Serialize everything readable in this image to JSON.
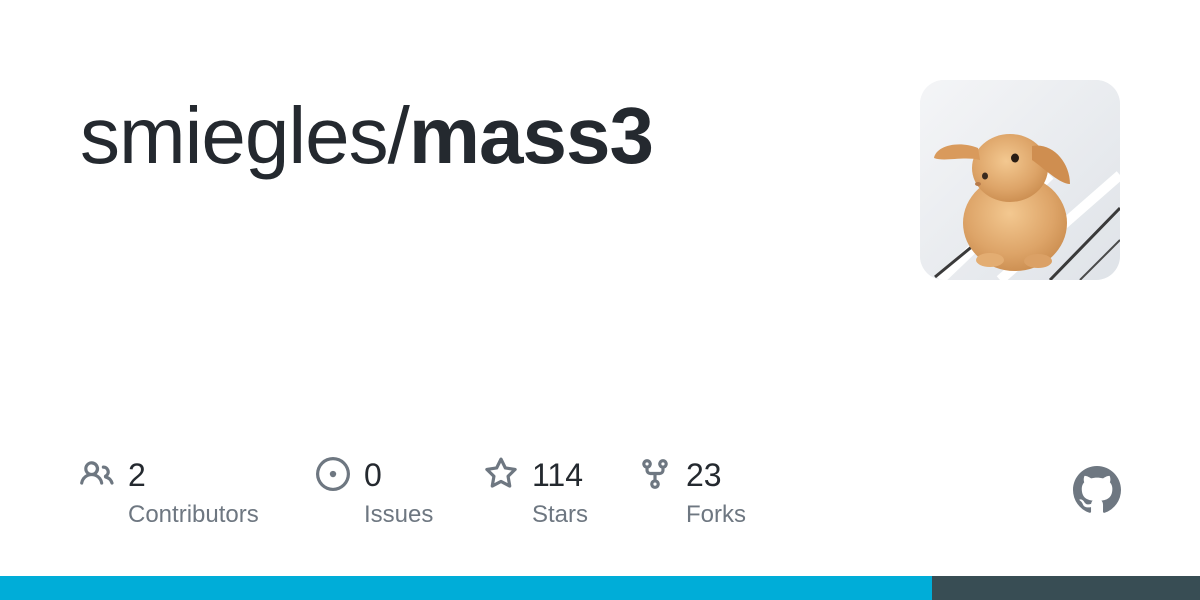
{
  "repo": {
    "owner": "smiegles/",
    "name": "mass3"
  },
  "stats": [
    {
      "value": "2",
      "label": "Contributors",
      "icon": "people-icon"
    },
    {
      "value": "0",
      "label": "Issues",
      "icon": "issue-opened-icon"
    },
    {
      "value": "114",
      "label": "Stars",
      "icon": "star-icon"
    },
    {
      "value": "23",
      "label": "Forks",
      "icon": "repo-forked-icon"
    }
  ],
  "avatar": {
    "icon": "owner-avatar-bunny"
  },
  "brand_icon": "github-mark-icon",
  "languages": [
    {
      "fraction": 0.777,
      "color": "#00ADD8"
    },
    {
      "fraction": 0.223,
      "color": "#384D54"
    }
  ],
  "colors": {
    "title": "#24292f",
    "muted": "#6e7781",
    "icon": "#6e7781"
  }
}
